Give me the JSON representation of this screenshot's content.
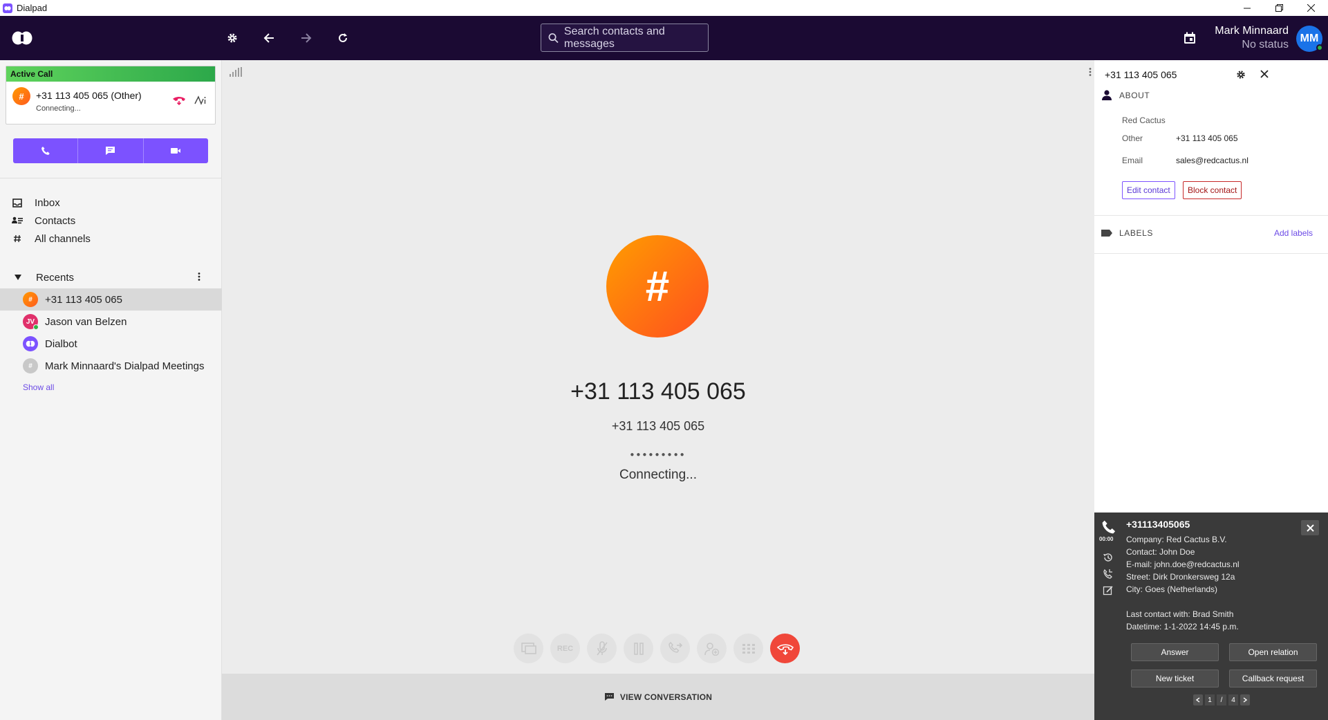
{
  "window": {
    "title": "Dialpad"
  },
  "header": {
    "search_placeholder": "Search contacts and messages",
    "user_name": "Mark Minnaard",
    "user_status": "No status",
    "user_initials": "MM"
  },
  "active_call": {
    "header": "Active Call",
    "number": "+31 113 405 065 (Other)",
    "status": "Connecting...",
    "avatar_glyph": "#"
  },
  "nav": {
    "inbox": "Inbox",
    "contacts": "Contacts",
    "channels": "All channels",
    "recents": "Recents"
  },
  "recents": [
    {
      "label": "+31 113 405 065",
      "avatar": "#",
      "color": "#ff7a10"
    },
    {
      "label": "Jason van Belzen",
      "avatar": "JV",
      "color": "#e0306a"
    },
    {
      "label": "Dialbot",
      "avatar": "",
      "color": "#7c52ff"
    },
    {
      "label": "Mark Minnaard's Dialpad Meetings",
      "avatar": "#",
      "color": "#c8c8c8"
    }
  ],
  "show_all": "Show all",
  "call": {
    "avatar_glyph": "#",
    "number_large": "+31 113 405 065",
    "number_small": "+31 113 405 065",
    "dots": "●●●●●●●●●",
    "status": "Connecting...",
    "rec_label": "REC",
    "view_conversation": "VIEW CONVERSATION"
  },
  "details": {
    "number": "+31 113 405 065",
    "about": "ABOUT",
    "company": "Red Cactus",
    "other_label": "Other",
    "other_value": "+31 113 405 065",
    "email_label": "Email",
    "email_value": "sales@redcactus.nl",
    "edit_contact": "Edit contact",
    "block_contact": "Block contact",
    "labels": "LABELS",
    "add_labels": "Add labels"
  },
  "popup": {
    "title": "+31113405065",
    "timer": "00:00",
    "company": "Company: Red Cactus B.V.",
    "contact": "Contact: John Doe",
    "email": "E-mail: john.doe@redcactus.nl",
    "street": "Street: Dirk Dronkersweg 12a",
    "city": "City: Goes (Netherlands)",
    "last_contact": "Last contact with: Brad Smith",
    "datetime": "Datetime: 1-1-2022 14:45 p.m.",
    "answer": "Answer",
    "open_relation": "Open relation",
    "new_ticket": "New ticket",
    "callback_request": "Callback request",
    "page_current": "1",
    "page_sep": "/",
    "page_total": "4"
  },
  "colors": {
    "header_bg": "#1b0a33",
    "accent": "#7c52ff",
    "active_call_green": "#2ca84a",
    "end_call_red": "#f0473a",
    "avatar_orange": "#ff7a10"
  }
}
